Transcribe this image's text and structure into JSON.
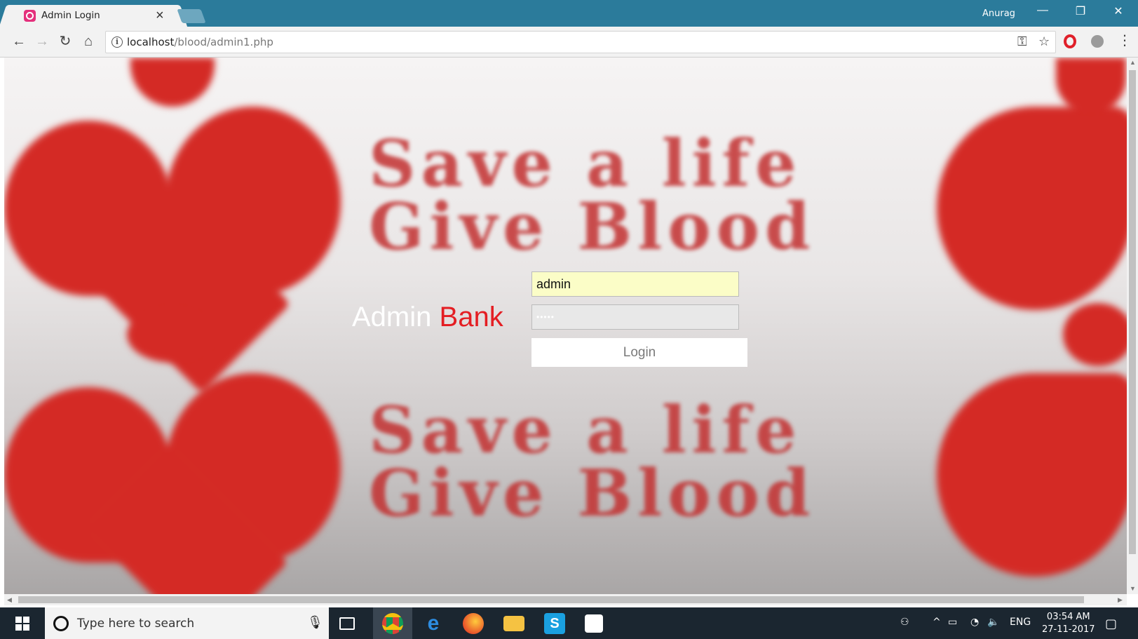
{
  "browser": {
    "tab_title": "Admin Login",
    "tab_close": "×",
    "profile_name": "Anurag",
    "window_controls": {
      "minimize": "—",
      "restore": "❐",
      "close": "✕"
    },
    "url_host": "localhost",
    "url_path": "/blood/admin1.php",
    "nav": {
      "back": "←",
      "forward": "→",
      "reload": "↻",
      "home": "⌂"
    },
    "omnibox_icons": {
      "key": "⚿",
      "star": "☆"
    },
    "menu": "⋮"
  },
  "page": {
    "background_text": [
      "Save a life",
      "Give Blood",
      "Save a life",
      "Give Blood"
    ],
    "label_main": "Admin",
    "label_accent": "Bank",
    "username_value": "admin",
    "password_value": "•••••",
    "login_button": "Login",
    "colors": {
      "accent": "#e41e23",
      "titlebar": "#2b7b9b",
      "username_bg": "#fbfdc7"
    }
  },
  "taskbar": {
    "search_placeholder": "Type here to search",
    "language": "ENG",
    "time": "03:54 AM",
    "date": "27-11-2017"
  }
}
